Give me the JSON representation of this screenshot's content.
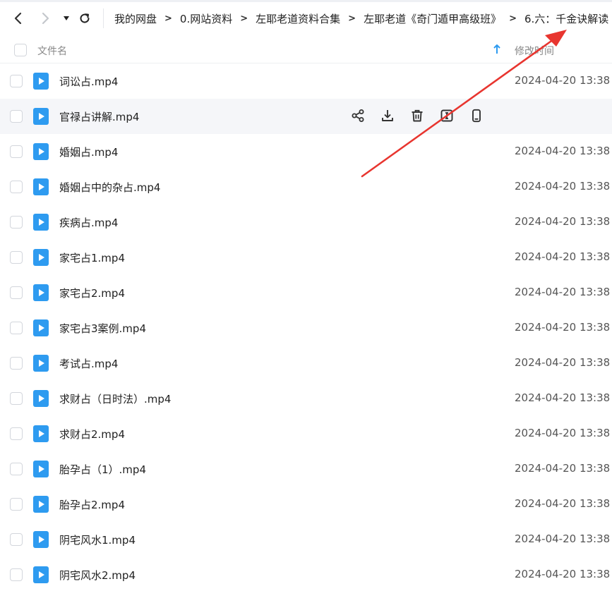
{
  "breadcrumb": {
    "items": [
      "我的网盘",
      "0.网站资料",
      "左耶老道资料合集",
      "左耶老道《奇门遁甲高级班》",
      "6.六：千金诀解读"
    ]
  },
  "header": {
    "name_label": "文件名",
    "time_label": "修改时间"
  },
  "files": [
    {
      "name": "词讼占.mp4",
      "time": "2024-04-20 13:38"
    },
    {
      "name": "官禄占讲解.mp4",
      "time": ""
    },
    {
      "name": "婚姻占.mp4",
      "time": "2024-04-20 13:38"
    },
    {
      "name": "婚姻占中的杂占.mp4",
      "time": "2024-04-20 13:38"
    },
    {
      "name": "疾病占.mp4",
      "time": "2024-04-20 13:38"
    },
    {
      "name": "家宅占1.mp4",
      "time": "2024-04-20 13:38"
    },
    {
      "name": "家宅占2.mp4",
      "time": "2024-04-20 13:38"
    },
    {
      "name": "家宅占3案例.mp4",
      "time": "2024-04-20 13:38"
    },
    {
      "name": "考试占.mp4",
      "time": "2024-04-20 13:38"
    },
    {
      "name": "求财占（日时法）.mp4",
      "time": "2024-04-20 13:38"
    },
    {
      "name": "求财占2.mp4",
      "time": "2024-04-20 13:38"
    },
    {
      "name": "胎孕占（1）.mp4",
      "time": "2024-04-20 13:38"
    },
    {
      "name": "胎孕占2.mp4",
      "time": "2024-04-20 13:38"
    },
    {
      "name": "阴宅风水1.mp4",
      "time": "2024-04-20 13:38"
    },
    {
      "name": "阴宅风水2.mp4",
      "time": "2024-04-20 13:38"
    }
  ],
  "icons": {
    "file": "video-file-icon",
    "actions": [
      "share-icon",
      "download-icon",
      "delete-icon",
      "rename-icon",
      "phone-icon"
    ]
  },
  "colors": {
    "accent": "#2e9bf0",
    "annotation_arrow": "#e8352f",
    "hover_row": "#f5f6f9"
  }
}
